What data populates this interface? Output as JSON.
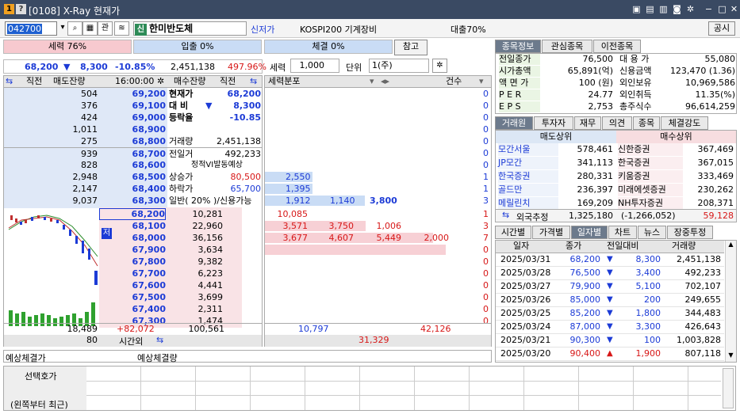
{
  "window": {
    "title": "[0108] X-Ray 현재가",
    "badge1": "1",
    "badge2": "?"
  },
  "toolbar": {
    "code": "042700",
    "kwan": "관",
    "stock_name": "한미반도체",
    "sin": "신",
    "sin_label": "신저가",
    "index": "KOSPI200 기계장비",
    "loan": "대출70%",
    "public_btn": "공시"
  },
  "bars": {
    "sell_power": "세력 76%",
    "buy_qty": "입출 0%",
    "exec": "체결 0%",
    "ref": "참고"
  },
  "price_line": {
    "price": "68,200",
    "arrow": "▼",
    "change": "8,300",
    "rate": "-10.85%",
    "volume": "2,451,138",
    "ratio": "497.96%"
  },
  "power": {
    "label": "세력",
    "qty": "1,000",
    "unit_label": "단위",
    "unit": "1(주)"
  },
  "ob_headers": {
    "h1": "직전",
    "h2": "매도잔량",
    "h3": "16:00:00",
    "h4": "매수잔량",
    "h5": "직전",
    "h6": "세력분포",
    "h7": "건수"
  },
  "asks": [
    {
      "qty": "504",
      "price": "69,200"
    },
    {
      "qty": "376",
      "price": "69,100"
    },
    {
      "qty": "424",
      "price": "69,000"
    },
    {
      "qty": "1,011",
      "price": "68,900"
    },
    {
      "qty": "275",
      "price": "68,800"
    },
    {
      "qty": "939",
      "price": "68,700"
    },
    {
      "qty": "828",
      "price": "68,600"
    },
    {
      "qty": "2,948",
      "price": "68,500"
    },
    {
      "qty": "2,147",
      "price": "68,400"
    },
    {
      "qty": "9,037",
      "price": "68,300"
    }
  ],
  "ask_info": [
    {
      "k": "현재가",
      "v": "68,200"
    },
    {
      "k": "대 비",
      "a": "▼",
      "v": "8,300"
    },
    {
      "k": "등락율",
      "v": "-10.85"
    },
    {
      "k": "",
      "v": ""
    },
    {
      "k": "거래량",
      "v": "2,451,138"
    },
    {
      "k": "전일거",
      "v": "492,233"
    },
    {
      "k": "정적VI발동예상",
      "v": ""
    },
    {
      "k": "상승가",
      "v": "80,500"
    },
    {
      "k": "하락가",
      "v": "65,700"
    },
    {
      "k": "일반( 20% )/신용가능",
      "v": ""
    }
  ],
  "ask_power": [
    {
      "a": "",
      "b": "",
      "c": "",
      "n": "0"
    },
    {
      "a": "",
      "b": "",
      "c": "",
      "n": "0"
    },
    {
      "a": "",
      "b": "",
      "c": "",
      "n": "0"
    },
    {
      "a": "",
      "b": "",
      "c": "",
      "n": "0"
    },
    {
      "a": "",
      "b": "",
      "c": "",
      "n": "0"
    },
    {
      "a": "",
      "b": "",
      "c": "",
      "n": "0"
    },
    {
      "a": "",
      "b": "",
      "c": "",
      "n": "0"
    },
    {
      "a": "2,550",
      "b": "",
      "c": "",
      "n": "1"
    },
    {
      "a": "1,395",
      "b": "",
      "c": "",
      "n": "1"
    },
    {
      "a": "1,912",
      "b": "1,140",
      "c": "3,800",
      "n": "3"
    }
  ],
  "bids": [
    {
      "price": "68,200",
      "qty": "10,281"
    },
    {
      "price": "68,100",
      "qty": "22,960"
    },
    {
      "price": "68,000",
      "qty": "36,156"
    },
    {
      "price": "67,900",
      "qty": "3,634"
    },
    {
      "price": "67,800",
      "qty": "9,382"
    },
    {
      "price": "67,700",
      "qty": "6,223"
    },
    {
      "price": "67,600",
      "qty": "4,441"
    },
    {
      "price": "67,500",
      "qty": "3,699"
    },
    {
      "price": "67,400",
      "qty": "2,311"
    },
    {
      "price": "67,300",
      "qty": "1,474"
    }
  ],
  "bid_power": [
    {
      "a": "10,085",
      "b": "",
      "c": "",
      "d": "",
      "n": "1"
    },
    {
      "a": "3,571",
      "b": "3,750",
      "c": "1,006",
      "d": "",
      "n": "3"
    },
    {
      "a": "3,677",
      "b": "4,607",
      "c": "5,449",
      "d": "2,000",
      "n": "7"
    },
    {
      "a": "",
      "b": "",
      "c": "",
      "d": "",
      "n": "0"
    },
    {
      "a": "",
      "b": "",
      "c": "",
      "d": "",
      "n": "0"
    },
    {
      "a": "",
      "b": "",
      "c": "",
      "d": "",
      "n": "0"
    },
    {
      "a": "",
      "b": "",
      "c": "",
      "d": "",
      "n": "0"
    },
    {
      "a": "",
      "b": "",
      "c": "",
      "d": "",
      "n": "0"
    },
    {
      "a": "",
      "b": "",
      "c": "",
      "d": "",
      "n": "0"
    },
    {
      "a": "",
      "b": "",
      "c": "",
      "d": "",
      "n": "0"
    }
  ],
  "jeo": "저",
  "totals": {
    "ask_total": "18,489",
    "diff": "+82,072",
    "bid_total": "100,561",
    "prev": "80",
    "after": "시간외",
    "p1": "10,797",
    "p2": "42,126",
    "p3": "31,329"
  },
  "expected": {
    "l1": "예상체결가",
    "l2": "예상체결량"
  },
  "select_quote": {
    "l1": "선택호가",
    "l2": "(왼쪽부터 최근)"
  },
  "right_tabs1": [
    "종목정보",
    "관심종목",
    "이전종목"
  ],
  "info": [
    {
      "k1": "전일종가",
      "v1": "76,500",
      "k2": "대 용 가",
      "v2": "55,080"
    },
    {
      "k1": "시가총액",
      "v1": "65,891(억)",
      "k2": "신용금액",
      "v2": "123,470 (1.36)"
    },
    {
      "k1": "액 면 가",
      "v1": "100 (원)",
      "k2": "외인보유",
      "v2": "10,969,586"
    },
    {
      "k1": "P E R",
      "v1": "24.77",
      "k2": "외인취득",
      "v2": "11.35(%)"
    },
    {
      "k1": "E P S",
      "v1": "2,753",
      "k2": "총주식수",
      "v2": "96,614,259"
    }
  ],
  "right_tabs2": [
    "거래원",
    "투자자",
    "재무",
    "의견",
    "종목",
    "체결강도"
  ],
  "broker_hdr": {
    "sell": "매도상위",
    "buy": "매수상위"
  },
  "brokers": [
    {
      "s": "모간서울",
      "sv": "578,461",
      "b": "신한증권",
      "bv": "367,469"
    },
    {
      "s": "JP모간",
      "sv": "341,113",
      "b": "한국증권",
      "bv": "367,015"
    },
    {
      "s": "한국증권",
      "sv": "280,331",
      "b": "키움증권",
      "bv": "333,469"
    },
    {
      "s": "골드만",
      "sv": "236,397",
      "b": "미래에셋증권",
      "bv": "230,262"
    },
    {
      "s": "메릴린치",
      "sv": "169,209",
      "b": "NH투자증권",
      "bv": "208,371"
    }
  ],
  "foreign": {
    "label": "외국추정",
    "sell": "1,325,180",
    "buy": "(-1,266,052)",
    "net": "59,128"
  },
  "right_tabs3": [
    "시간별",
    "가격별",
    "일자별",
    "차트",
    "뉴스",
    "장중투정"
  ],
  "daily_hdr": [
    "일자",
    "종가",
    "전일대비",
    "거래량"
  ],
  "daily": [
    {
      "d": "2025/03/31",
      "c": "68,200",
      "a": "▼",
      "ch": "8,300",
      "v": "2,451,138",
      "up": false
    },
    {
      "d": "2025/03/28",
      "c": "76,500",
      "a": "▼",
      "ch": "3,400",
      "v": "492,233",
      "up": false
    },
    {
      "d": "2025/03/27",
      "c": "79,900",
      "a": "▼",
      "ch": "5,100",
      "v": "702,107",
      "up": false
    },
    {
      "d": "2025/03/26",
      "c": "85,000",
      "a": "▼",
      "ch": "200",
      "v": "249,655",
      "up": false
    },
    {
      "d": "2025/03/25",
      "c": "85,200",
      "a": "▼",
      "ch": "1,800",
      "v": "344,483",
      "up": false
    },
    {
      "d": "2025/03/24",
      "c": "87,000",
      "a": "▼",
      "ch": "3,300",
      "v": "426,643",
      "up": false
    },
    {
      "d": "2025/03/21",
      "c": "90,300",
      "a": "▼",
      "ch": "100",
      "v": "1,003,828",
      "up": false
    },
    {
      "d": "2025/03/20",
      "c": "90,400",
      "a": "▲",
      "ch": "1,900",
      "v": "807,118",
      "up": true
    }
  ]
}
